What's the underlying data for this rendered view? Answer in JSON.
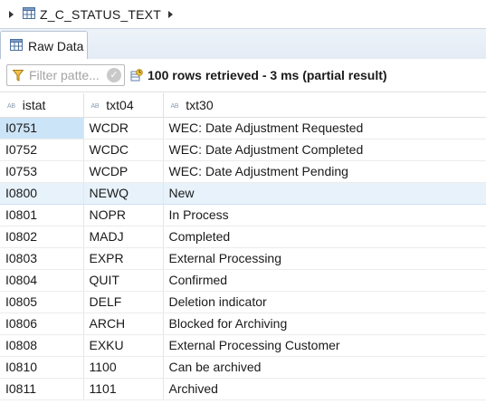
{
  "breadcrumb": {
    "table_name": "Z_C_STATUS_TEXT"
  },
  "tabs": [
    {
      "label": "Raw Data"
    }
  ],
  "toolbar": {
    "filter_placeholder": "Filter patte...",
    "status_text": "100 rows retrieved - 3 ms (partial result)"
  },
  "grid": {
    "type_marker": "AB",
    "columns": [
      "istat",
      "txt04",
      "txt30"
    ],
    "rows": [
      [
        "I0751",
        "WCDR",
        "WEC: Date Adjustment Requested"
      ],
      [
        "I0752",
        "WCDC",
        "WEC: Date Adjustment Completed"
      ],
      [
        "I0753",
        "WCDP",
        "WEC: Date Adjustment Pending"
      ],
      [
        "I0800",
        "NEWQ",
        "New"
      ],
      [
        "I0801",
        "NOPR",
        "In Process"
      ],
      [
        "I0802",
        "MADJ",
        "Completed"
      ],
      [
        "I0803",
        "EXPR",
        "External Processing"
      ],
      [
        "I0804",
        "QUIT",
        "Confirmed"
      ],
      [
        "I0805",
        "DELF",
        "Deletion indicator"
      ],
      [
        "I0806",
        "ARCH",
        "Blocked for Archiving"
      ],
      [
        "I0808",
        "EXKU",
        "External Processing Customer"
      ],
      [
        "I0810",
        "1100",
        "Can be archived"
      ],
      [
        "I0811",
        "1101",
        "Archived"
      ]
    ]
  },
  "icons": {
    "expand": "chevron-right-icon",
    "table": "table-icon",
    "filter": "funnel-icon",
    "clear": "clear-icon",
    "status": "data-preview-icon"
  },
  "colors": {
    "selected_cell": "#cce4f7",
    "hover_row": "#e7f2fb",
    "tab_strip": "#e3ebf5"
  }
}
